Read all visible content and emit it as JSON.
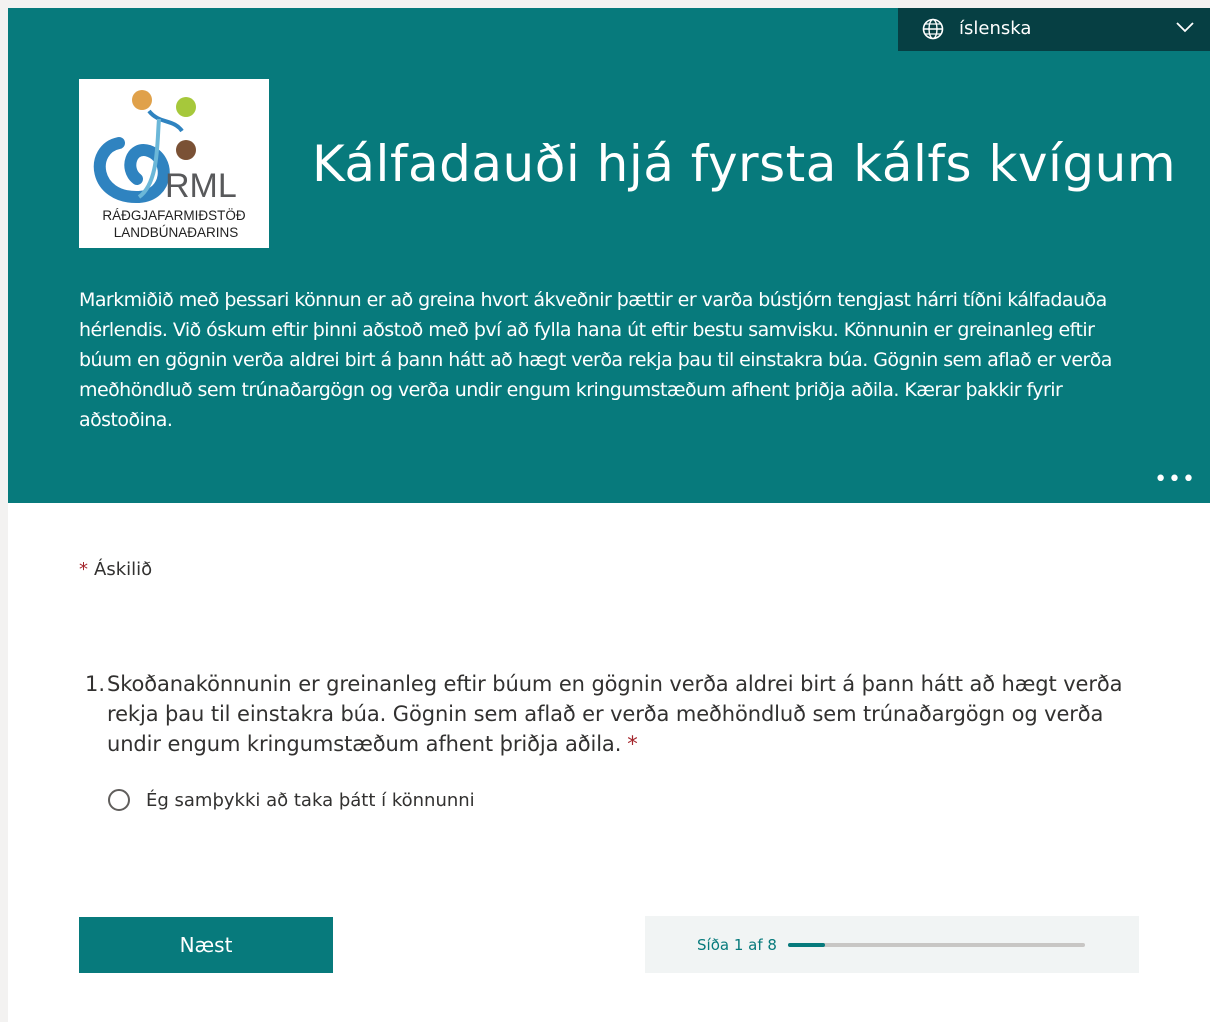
{
  "header": {
    "language": "íslenska",
    "title": "Kálfadauði hjá fyrsta kálfs kvígum",
    "description": "Markmiðið með þessari könnun er að greina hvort ákveðnir þættir er varða bústjórn tengjast hárri tíðni kálfadauða hérlendis. Við óskum eftir þinni aðstoð með því að fylla hana út eftir bestu samvisku. Könnunin er greinanleg eftir búum en gögnin verða aldrei birt á þann hátt að hægt verða rekja þau til einstakra búa. Gögnin sem aflað er verða meðhöndluð sem trúnaðargögn og verða undir engum kringumstæðum afhent þriðja aðila. Kærar þakkir fyrir aðstoðina.",
    "more_icon": "more-horizontal-icon"
  },
  "logo": {
    "abbr": "RML",
    "line1": "RÁÐGJAFARMIÐSTÖÐ",
    "line2": "LANDBÚNAÐARINS"
  },
  "form": {
    "required_star": "*",
    "required_label": "Áskilið",
    "question": {
      "number": "1.",
      "text": "Skoðanakönnunin er greinanleg eftir búum en gögnin verða aldrei birt á þann hátt að hægt verða rekja þau til einstakra búa. Gögnin sem aflað er verða meðhöndluð sem trúnaðargögn og verða undir engum kringumstæðum afhent þriðja aðila.",
      "star": "*",
      "option": "Ég samþykki að taka þátt í könnunni"
    },
    "next_label": "Næst",
    "progress": {
      "label": "Síða 1 af 8",
      "current": 1,
      "total": 8
    }
  },
  "colors": {
    "header_bg": "#077a7c",
    "lang_bg": "#063f43",
    "required": "#a4262c"
  }
}
